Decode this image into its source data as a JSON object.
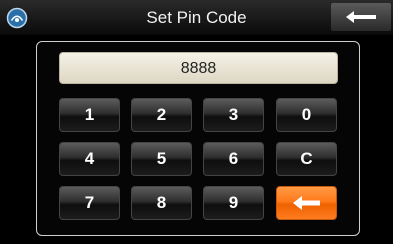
{
  "header": {
    "title": "Set Pin Code",
    "home_icon": "home-icon",
    "back_icon": "back-arrow-icon"
  },
  "pin_display": {
    "value": "8888"
  },
  "keypad": {
    "key_1": "1",
    "key_2": "2",
    "key_3": "3",
    "key_0": "0",
    "key_4": "4",
    "key_5": "5",
    "key_6": "6",
    "key_clear": "C",
    "key_7": "7",
    "key_8": "8",
    "key_9": "9",
    "backspace_icon": "left-arrow-icon"
  },
  "colors": {
    "accent": "#ff7a1a",
    "display_bg": "#ece8d8"
  }
}
